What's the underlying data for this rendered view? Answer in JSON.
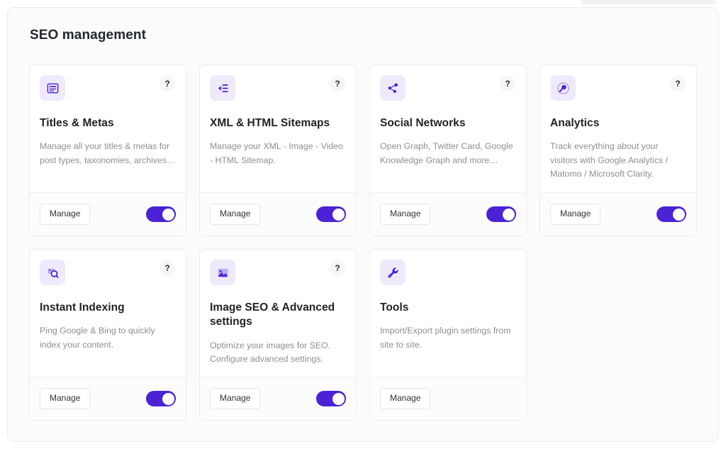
{
  "page": {
    "title": "SEO management"
  },
  "labels": {
    "manage": "Manage",
    "help": "?"
  },
  "theme": {
    "accent": "#4b22d5",
    "icon_tile_bg": "#eeeafc",
    "page_bg": "#fbfbfc",
    "card_bg": "#ffffff",
    "title_color": "#1f2125",
    "desc_color": "#8b8e95"
  },
  "cards": [
    {
      "icon": "titles-metas-icon",
      "title": "Titles & Metas",
      "description": "Manage all your titles & metas for post types, taxonomies, archives…",
      "manage_label": "Manage",
      "has_help": true,
      "has_toggle": true,
      "toggle_on": true
    },
    {
      "icon": "sitemap-icon",
      "title": "XML & HTML Sitemaps",
      "description": "Manage your XML - Image - Video - HTML Sitemap.",
      "manage_label": "Manage",
      "has_help": true,
      "has_toggle": true,
      "toggle_on": true
    },
    {
      "icon": "social-share-icon",
      "title": "Social Networks",
      "description": "Open Graph, Twitter Card, Google Knowledge Graph and more…",
      "manage_label": "Manage",
      "has_help": true,
      "has_toggle": true,
      "toggle_on": true
    },
    {
      "icon": "analytics-magnifier-icon",
      "title": "Analytics",
      "description": "Track everything about your visitors with Google Analytics / Matomo / Microsoft Clarity.",
      "manage_label": "Manage",
      "has_help": true,
      "has_toggle": true,
      "toggle_on": true
    },
    {
      "icon": "instant-indexing-icon",
      "title": "Instant Indexing",
      "description": "Ping Google & Bing to quickly index your content.",
      "manage_label": "Manage",
      "has_help": true,
      "has_toggle": true,
      "toggle_on": true
    },
    {
      "icon": "image-seo-icon",
      "title": "Image SEO & Advanced settings",
      "description": "Optimize your images for SEO. Configure advanced settings.",
      "manage_label": "Manage",
      "has_help": true,
      "has_toggle": true,
      "toggle_on": true
    },
    {
      "icon": "wrench-icon",
      "title": "Tools",
      "description": "Import/Export plugin settings from site to site.",
      "manage_label": "Manage",
      "has_help": false,
      "has_toggle": false,
      "toggle_on": false
    }
  ]
}
